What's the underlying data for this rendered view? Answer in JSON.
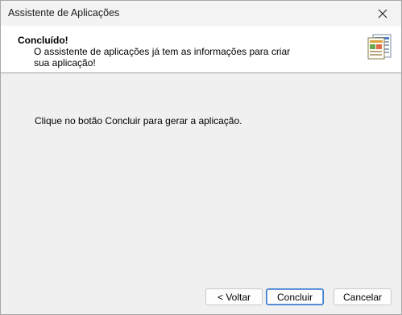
{
  "window": {
    "title": "Assistente de Aplicações"
  },
  "header": {
    "title": "Concluído!",
    "description": "O assistente de aplicações já tem as informações para criar sua aplicação!",
    "icon": "wizard-forms-icon"
  },
  "main": {
    "instruction": "Clique no botão Concluir para gerar a aplicação."
  },
  "buttons": {
    "back_label": "< Voltar",
    "finish_label": "Concluir",
    "cancel_label": "Cancelar"
  },
  "colors": {
    "default_button_border": "#3a78c8",
    "header_background": "#ffffff",
    "body_background": "#f0f0f0"
  }
}
